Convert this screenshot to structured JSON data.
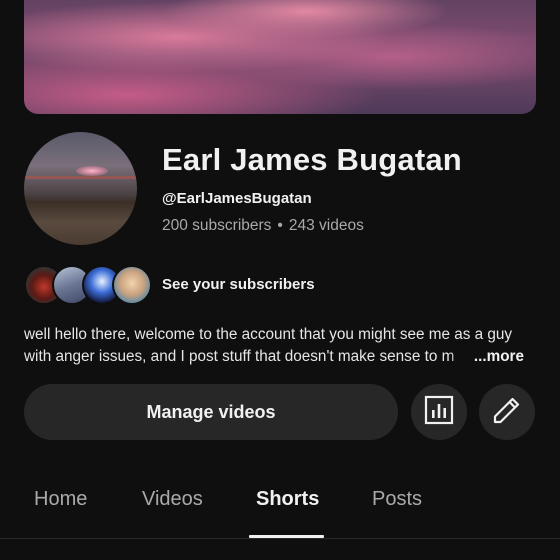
{
  "channel": {
    "name": "Earl James Bugatan",
    "handle": "@EarlJamesBugatan",
    "subscribers": "200 subscribers",
    "separator": "•",
    "videos": "243 videos"
  },
  "subscribers_link": "See your subscribers",
  "description": {
    "line1": "well hello there, welcome to the account that you might see me as a guy",
    "line2": "with anger issues, and I post stuff that doesn't make sense to m",
    "more": "...more"
  },
  "actions": {
    "manage_label": "Manage videos"
  },
  "icons": {
    "analytics": "analytics-icon",
    "edit": "pencil-icon"
  },
  "tabs": [
    {
      "label": "Home"
    },
    {
      "label": "Videos"
    },
    {
      "label": "Shorts",
      "active": true
    },
    {
      "label": "Posts"
    }
  ],
  "colors": {
    "background": "#0f0f0f",
    "button": "#272727",
    "text_primary": "#f1f1f1",
    "text_secondary": "#aaaaaa"
  }
}
